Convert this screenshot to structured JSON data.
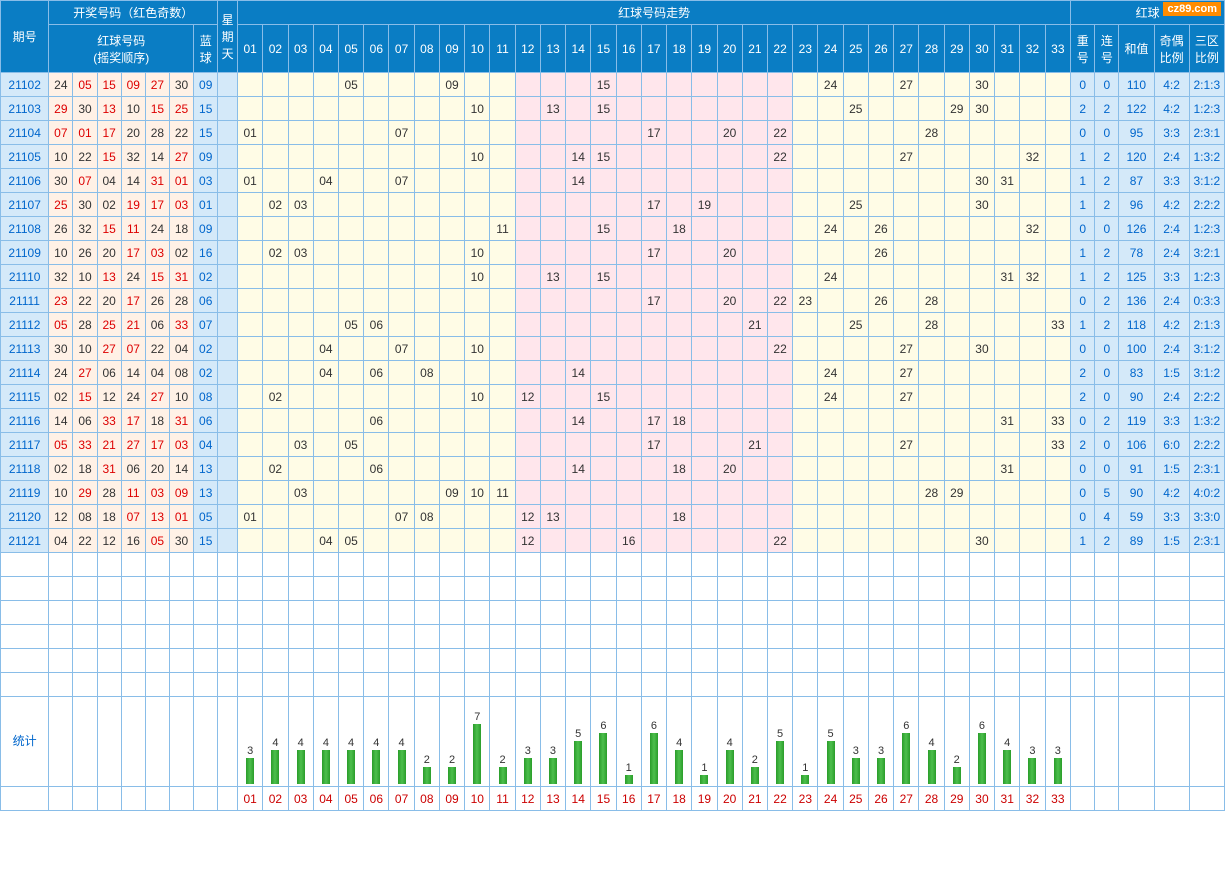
{
  "watermark": "cz89.com",
  "header": {
    "period": "期号",
    "draw_section": "开奖号码（红色奇数）",
    "trend_section": "红球号码走势",
    "red_right": "红球",
    "red_balls": "红球号码\n(摇奖顺序)",
    "blue_ball": "蓝球",
    "weekday": "星期天",
    "stat_repeat": "重号",
    "stat_consec": "连号",
    "stat_sum": "和值",
    "stat_oddeven": "奇偶比例",
    "stat_zone": "三区比例",
    "stats_label": "统计"
  },
  "trend_cols": [
    "01",
    "02",
    "03",
    "04",
    "05",
    "06",
    "07",
    "08",
    "09",
    "10",
    "11",
    "12",
    "13",
    "14",
    "15",
    "16",
    "17",
    "18",
    "19",
    "20",
    "21",
    "22",
    "23",
    "24",
    "25",
    "26",
    "27",
    "28",
    "29",
    "30",
    "31",
    "32",
    "33"
  ],
  "rows": [
    {
      "period": "21102",
      "balls": [
        "24",
        "05",
        "15",
        "09",
        "27",
        "30"
      ],
      "blue": "09",
      "hits": [
        "05",
        "09",
        "15",
        "24",
        "27",
        "30"
      ],
      "repeat": "0",
      "consec": "0",
      "sum": "110",
      "oe": "4:2",
      "zone": "2:1:3"
    },
    {
      "period": "21103",
      "balls": [
        "29",
        "30",
        "13",
        "10",
        "15",
        "25"
      ],
      "blue": "15",
      "hits": [
        "10",
        "13",
        "15",
        "25",
        "29",
        "30"
      ],
      "repeat": "2",
      "consec": "2",
      "sum": "122",
      "oe": "4:2",
      "zone": "1:2:3"
    },
    {
      "period": "21104",
      "balls": [
        "07",
        "01",
        "17",
        "20",
        "28",
        "22"
      ],
      "blue": "15",
      "hits": [
        "01",
        "07",
        "17",
        "20",
        "22",
        "28"
      ],
      "repeat": "0",
      "consec": "0",
      "sum": "95",
      "oe": "3:3",
      "zone": "2:3:1"
    },
    {
      "period": "21105",
      "balls": [
        "10",
        "22",
        "15",
        "32",
        "14",
        "27"
      ],
      "blue": "09",
      "hits": [
        "10",
        "14",
        "15",
        "22",
        "27",
        "32"
      ],
      "repeat": "1",
      "consec": "2",
      "sum": "120",
      "oe": "2:4",
      "zone": "1:3:2"
    },
    {
      "period": "21106",
      "balls": [
        "30",
        "07",
        "04",
        "14",
        "31",
        "01"
      ],
      "blue": "03",
      "hits": [
        "01",
        "04",
        "07",
        "14",
        "30",
        "31"
      ],
      "repeat": "1",
      "consec": "2",
      "sum": "87",
      "oe": "3:3",
      "zone": "3:1:2"
    },
    {
      "period": "21107",
      "balls": [
        "25",
        "30",
        "02",
        "19",
        "17",
        "03"
      ],
      "blue": "01",
      "hits": [
        "02",
        "03",
        "17",
        "19",
        "25",
        "30"
      ],
      "repeat": "1",
      "consec": "2",
      "sum": "96",
      "oe": "4:2",
      "zone": "2:2:2"
    },
    {
      "period": "21108",
      "balls": [
        "26",
        "32",
        "15",
        "11",
        "24",
        "18"
      ],
      "blue": "09",
      "hits": [
        "11",
        "15",
        "18",
        "24",
        "26",
        "32"
      ],
      "repeat": "0",
      "consec": "0",
      "sum": "126",
      "oe": "2:4",
      "zone": "1:2:3"
    },
    {
      "period": "21109",
      "balls": [
        "10",
        "26",
        "20",
        "17",
        "03",
        "02"
      ],
      "blue": "16",
      "hits": [
        "02",
        "03",
        "10",
        "17",
        "20",
        "26"
      ],
      "repeat": "1",
      "consec": "2",
      "sum": "78",
      "oe": "2:4",
      "zone": "3:2:1"
    },
    {
      "period": "21110",
      "balls": [
        "32",
        "10",
        "13",
        "24",
        "15",
        "31"
      ],
      "blue": "02",
      "hits": [
        "10",
        "13",
        "15",
        "24",
        "31",
        "32"
      ],
      "repeat": "1",
      "consec": "2",
      "sum": "125",
      "oe": "3:3",
      "zone": "1:2:3"
    },
    {
      "period": "21111",
      "balls": [
        "23",
        "22",
        "20",
        "17",
        "26",
        "28"
      ],
      "blue": "06",
      "hits": [
        "17",
        "20",
        "22",
        "23",
        "26",
        "28"
      ],
      "repeat": "0",
      "consec": "2",
      "sum": "136",
      "oe": "2:4",
      "zone": "0:3:3"
    },
    {
      "period": "21112",
      "balls": [
        "05",
        "28",
        "25",
        "21",
        "06",
        "33"
      ],
      "blue": "07",
      "hits": [
        "05",
        "06",
        "21",
        "25",
        "28",
        "33"
      ],
      "repeat": "1",
      "consec": "2",
      "sum": "118",
      "oe": "4:2",
      "zone": "2:1:3"
    },
    {
      "period": "21113",
      "balls": [
        "30",
        "10",
        "27",
        "07",
        "22",
        "04"
      ],
      "blue": "02",
      "hits": [
        "04",
        "07",
        "10",
        "22",
        "27",
        "30"
      ],
      "repeat": "0",
      "consec": "0",
      "sum": "100",
      "oe": "2:4",
      "zone": "3:1:2"
    },
    {
      "period": "21114",
      "balls": [
        "24",
        "27",
        "06",
        "14",
        "04",
        "08"
      ],
      "blue": "02",
      "hits": [
        "04",
        "06",
        "08",
        "14",
        "24",
        "27"
      ],
      "repeat": "2",
      "consec": "0",
      "sum": "83",
      "oe": "1:5",
      "zone": "3:1:2"
    },
    {
      "period": "21115",
      "balls": [
        "02",
        "15",
        "12",
        "24",
        "27",
        "10"
      ],
      "blue": "08",
      "hits": [
        "02",
        "10",
        "12",
        "15",
        "24",
        "27"
      ],
      "repeat": "2",
      "consec": "0",
      "sum": "90",
      "oe": "2:4",
      "zone": "2:2:2"
    },
    {
      "period": "21116",
      "balls": [
        "14",
        "06",
        "33",
        "17",
        "18",
        "31"
      ],
      "blue": "06",
      "hits": [
        "06",
        "14",
        "17",
        "18",
        "31",
        "33"
      ],
      "repeat": "0",
      "consec": "2",
      "sum": "119",
      "oe": "3:3",
      "zone": "1:3:2"
    },
    {
      "period": "21117",
      "balls": [
        "05",
        "33",
        "21",
        "27",
        "17",
        "03"
      ],
      "blue": "04",
      "hits": [
        "03",
        "05",
        "17",
        "21",
        "27",
        "33"
      ],
      "repeat": "2",
      "consec": "0",
      "sum": "106",
      "oe": "6:0",
      "zone": "2:2:2"
    },
    {
      "period": "21118",
      "balls": [
        "02",
        "18",
        "31",
        "06",
        "20",
        "14"
      ],
      "blue": "13",
      "hits": [
        "02",
        "06",
        "14",
        "18",
        "20",
        "31"
      ],
      "repeat": "0",
      "consec": "0",
      "sum": "91",
      "oe": "1:5",
      "zone": "2:3:1"
    },
    {
      "period": "21119",
      "balls": [
        "10",
        "29",
        "28",
        "11",
        "03",
        "09"
      ],
      "blue": "13",
      "hits": [
        "03",
        "09",
        "10",
        "11",
        "28",
        "29"
      ],
      "repeat": "0",
      "consec": "5",
      "sum": "90",
      "oe": "4:2",
      "zone": "4:0:2"
    },
    {
      "period": "21120",
      "balls": [
        "12",
        "08",
        "18",
        "07",
        "13",
        "01"
      ],
      "blue": "05",
      "hits": [
        "01",
        "07",
        "08",
        "12",
        "13",
        "18"
      ],
      "repeat": "0",
      "consec": "4",
      "sum": "59",
      "oe": "3:3",
      "zone": "3:3:0"
    },
    {
      "period": "21121",
      "balls": [
        "04",
        "22",
        "12",
        "16",
        "05",
        "30"
      ],
      "blue": "15",
      "hits": [
        "04",
        "05",
        "12",
        "16",
        "22",
        "30"
      ],
      "repeat": "1",
      "consec": "2",
      "sum": "89",
      "oe": "1:5",
      "zone": "2:3:1"
    }
  ],
  "chart_data": {
    "type": "bar",
    "title": "统计",
    "categories": [
      "01",
      "02",
      "03",
      "04",
      "05",
      "06",
      "07",
      "08",
      "09",
      "10",
      "11",
      "12",
      "13",
      "14",
      "15",
      "16",
      "17",
      "18",
      "19",
      "20",
      "21",
      "22",
      "23",
      "24",
      "25",
      "26",
      "27",
      "28",
      "29",
      "30",
      "31",
      "32",
      "33"
    ],
    "values": [
      3,
      4,
      4,
      4,
      4,
      4,
      4,
      2,
      2,
      7,
      2,
      3,
      3,
      5,
      6,
      1,
      6,
      4,
      1,
      4,
      2,
      5,
      1,
      5,
      3,
      3,
      6,
      4,
      2,
      6,
      4,
      3,
      3
    ],
    "ylim": [
      0,
      7
    ]
  }
}
